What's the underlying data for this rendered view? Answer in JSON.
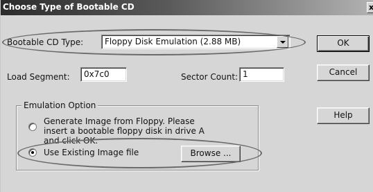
{
  "window": {
    "title": "Choose Type of Bootable CD",
    "close_glyph": "x"
  },
  "boot_type": {
    "label": "Bootable CD Type:",
    "selected": "Floppy Disk Emulation (2.88 MB)"
  },
  "load_segment": {
    "label": "Load Segment:",
    "value": "0x7c0"
  },
  "sector_count": {
    "label": "Sector Count:",
    "value": "1"
  },
  "emulation_option": {
    "group_label": "Emulation Option",
    "option_floppy": "Generate Image from Floppy. Please insert a bootable floppy disk in drive A and click OK.",
    "option_existing": "Use Existing Image file",
    "browse_label": "Browse ...",
    "selected": "option_existing"
  },
  "buttons": {
    "ok": "OK",
    "cancel": "Cancel",
    "help": "Help"
  },
  "icons": {
    "dropdown": "chevron-down-icon",
    "close": "close-icon"
  },
  "colors": {
    "dialog_bg": "#d6d6d6",
    "title_start": "#2b2b2b",
    "title_end": "#b2b2b2",
    "annotation_oval": "#6a6a6a"
  }
}
